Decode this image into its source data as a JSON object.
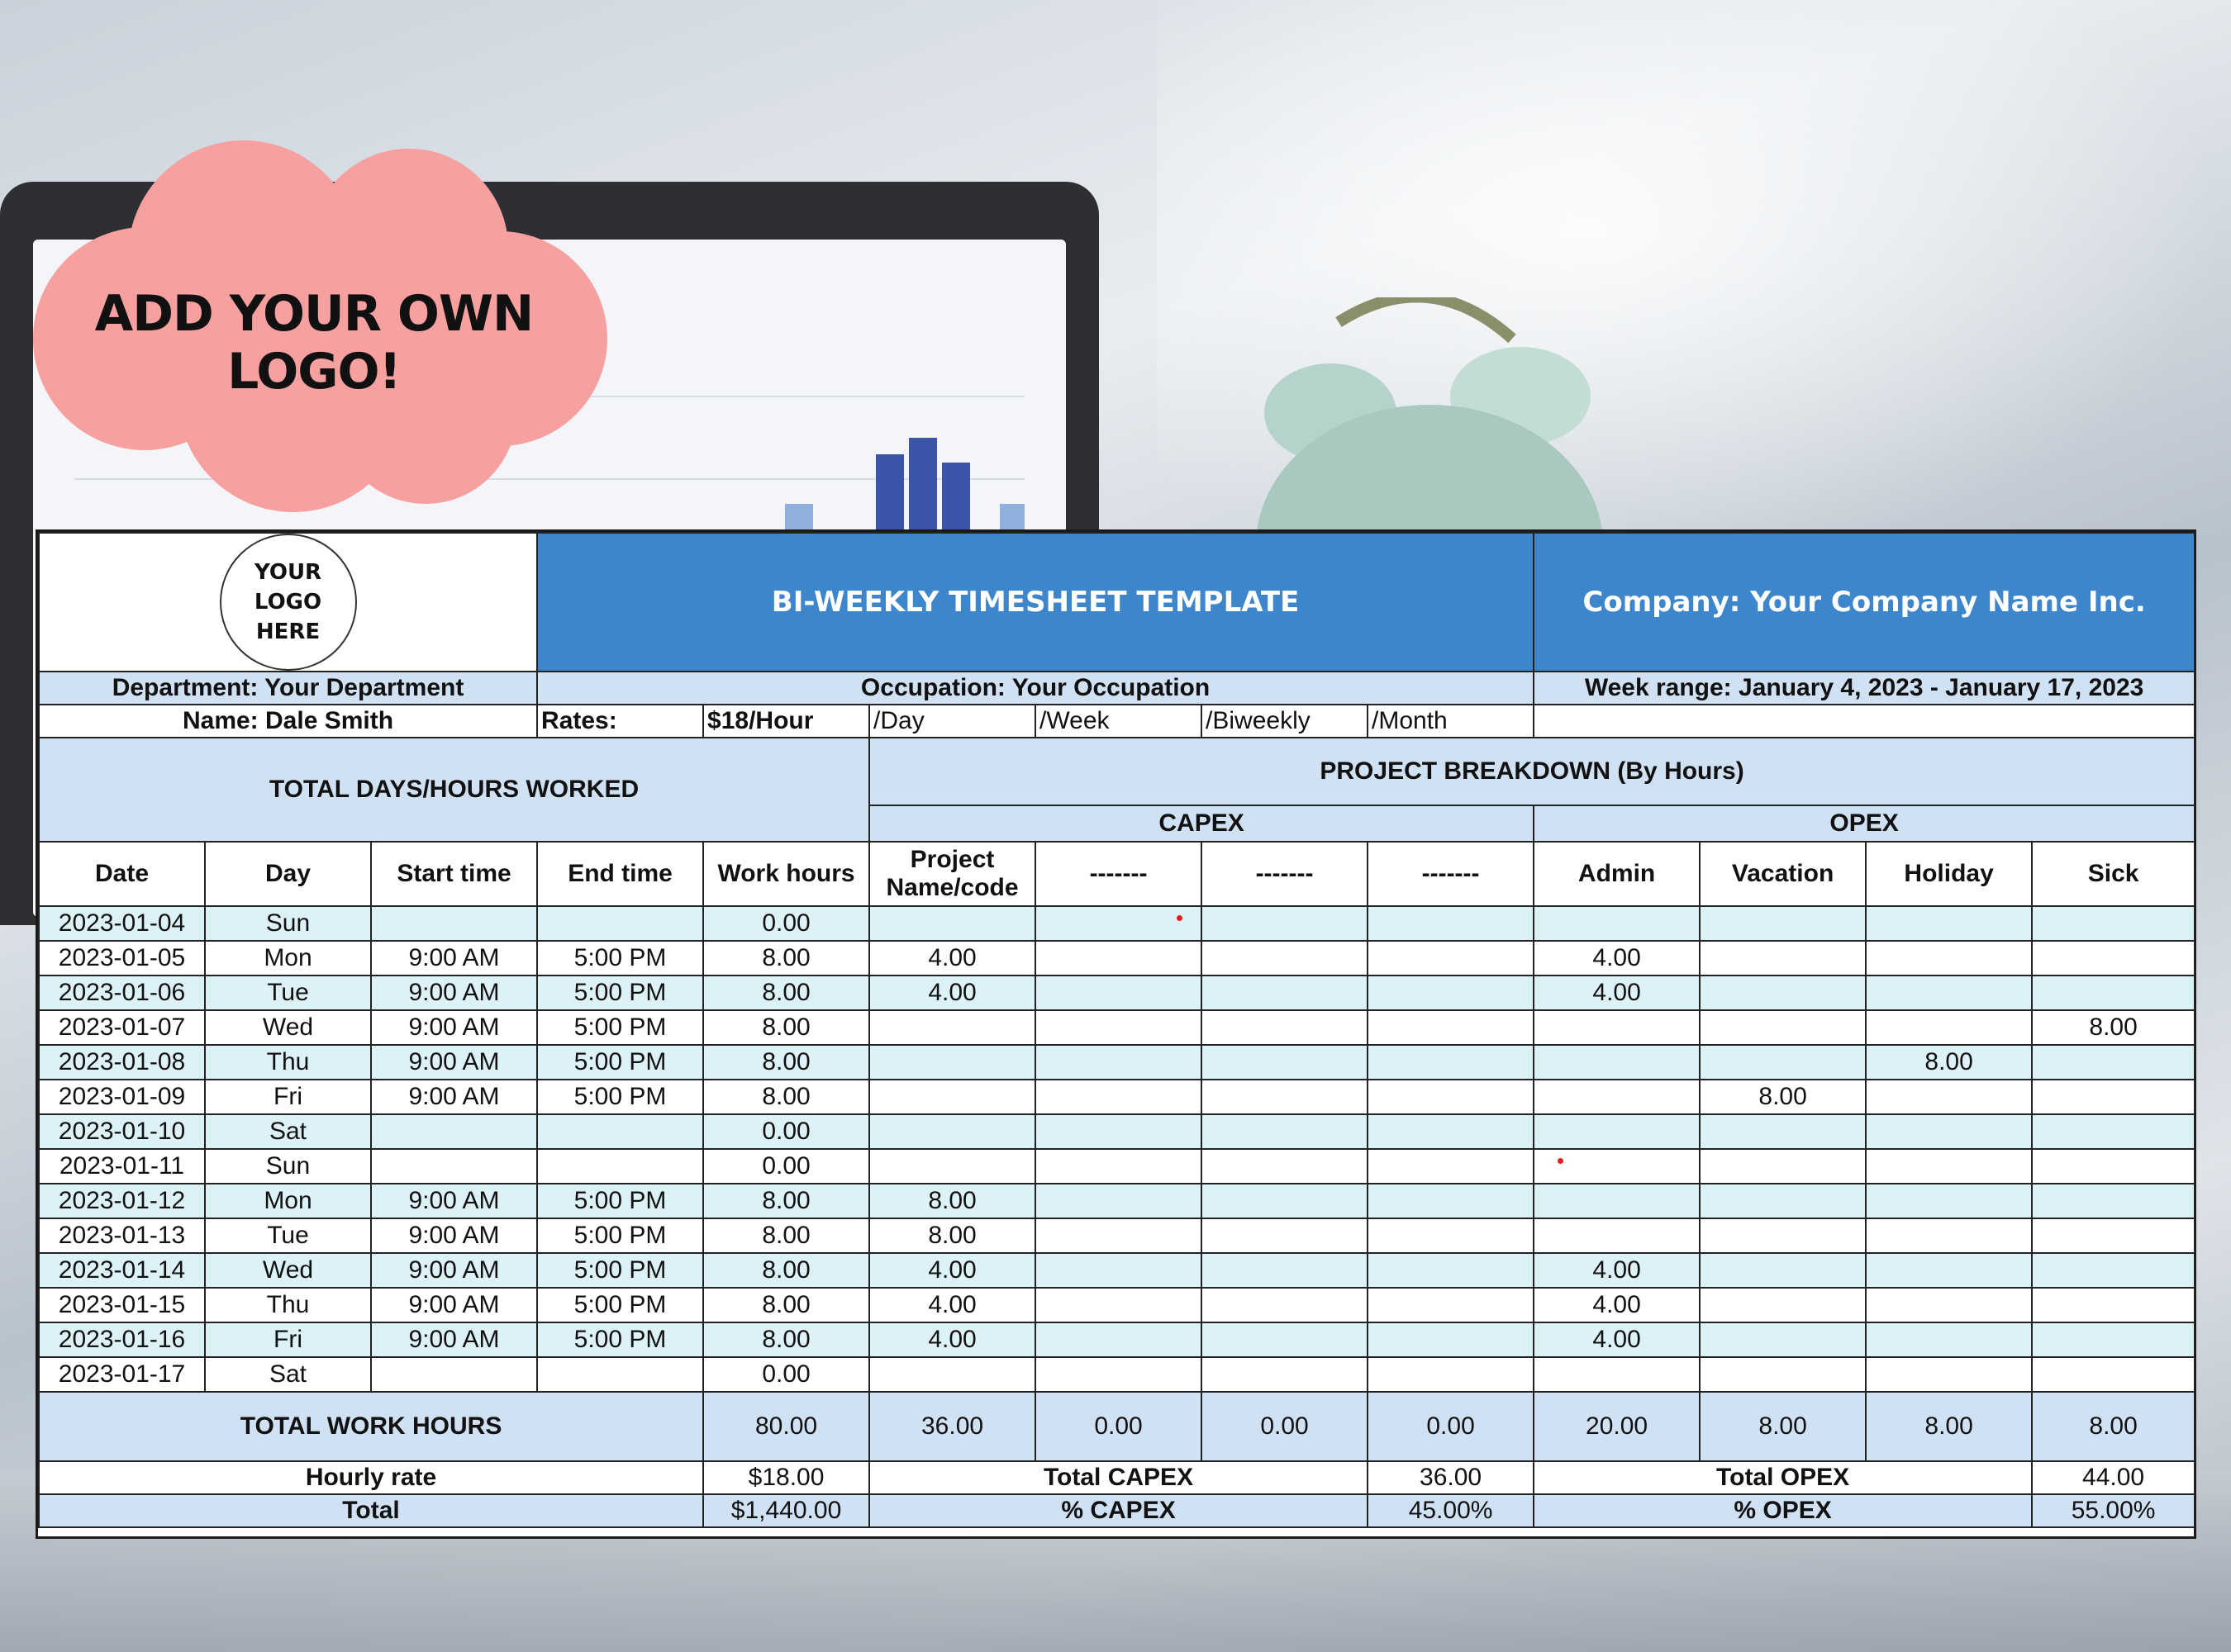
{
  "promo": {
    "cloud_text": "ADD YOUR OWN LOGO!",
    "cloud_color": "#f6a0a0"
  },
  "header": {
    "logo_lines": [
      "YOUR",
      "LOGO",
      "HERE"
    ],
    "title": "BI-WEEKLY TIMESHEET TEMPLATE",
    "company": "Company: Your Company Name Inc.",
    "accent": "#3d86cb"
  },
  "info": {
    "department": "Department: Your Department",
    "occupation": "Occupation: Your Occupation",
    "week_range": "Week range: January 4, 2023 - January 17, 2023",
    "name": "Name: Dale Smith",
    "rates_label": "Rates:",
    "rate_hour": "$18/Hour",
    "rate_day": "/Day",
    "rate_week": "/Week",
    "rate_biweekly": "/Biweekly",
    "rate_month": "/Month"
  },
  "sections": {
    "total_days": "TOTAL DAYS/HOURS WORKED",
    "project_breakdown": "PROJECT BREAKDOWN (By Hours)",
    "capex": "CAPEX",
    "opex": "OPEX"
  },
  "columns": [
    "Date",
    "Day",
    "Start time",
    "End time",
    "Work hours",
    "Project Name/code",
    "-------",
    "-------",
    "-------",
    "Admin",
    "Vacation",
    "Holiday",
    "Sick"
  ],
  "rows": [
    {
      "date": "2023-01-04",
      "day": "Sun",
      "start": "",
      "end": "",
      "hours": "0.00",
      "project": "",
      "c2": "",
      "c3": "",
      "c4": "",
      "admin": "",
      "vacation": "",
      "holiday": "",
      "sick": ""
    },
    {
      "date": "2023-01-05",
      "day": "Mon",
      "start": "9:00 AM",
      "end": "5:00 PM",
      "hours": "8.00",
      "project": "4.00",
      "c2": "",
      "c3": "",
      "c4": "",
      "admin": "4.00",
      "vacation": "",
      "holiday": "",
      "sick": ""
    },
    {
      "date": "2023-01-06",
      "day": "Tue",
      "start": "9:00 AM",
      "end": "5:00 PM",
      "hours": "8.00",
      "project": "4.00",
      "c2": "",
      "c3": "",
      "c4": "",
      "admin": "4.00",
      "vacation": "",
      "holiday": "",
      "sick": ""
    },
    {
      "date": "2023-01-07",
      "day": "Wed",
      "start": "9:00 AM",
      "end": "5:00 PM",
      "hours": "8.00",
      "project": "",
      "c2": "",
      "c3": "",
      "c4": "",
      "admin": "",
      "vacation": "",
      "holiday": "",
      "sick": "8.00"
    },
    {
      "date": "2023-01-08",
      "day": "Thu",
      "start": "9:00 AM",
      "end": "5:00 PM",
      "hours": "8.00",
      "project": "",
      "c2": "",
      "c3": "",
      "c4": "",
      "admin": "",
      "vacation": "",
      "holiday": "8.00",
      "sick": ""
    },
    {
      "date": "2023-01-09",
      "day": "Fri",
      "start": "9:00 AM",
      "end": "5:00 PM",
      "hours": "8.00",
      "project": "",
      "c2": "",
      "c3": "",
      "c4": "",
      "admin": "",
      "vacation": "8.00",
      "holiday": "",
      "sick": ""
    },
    {
      "date": "2023-01-10",
      "day": "Sat",
      "start": "",
      "end": "",
      "hours": "0.00",
      "project": "",
      "c2": "",
      "c3": "",
      "c4": "",
      "admin": "",
      "vacation": "",
      "holiday": "",
      "sick": ""
    },
    {
      "date": "2023-01-11",
      "day": "Sun",
      "start": "",
      "end": "",
      "hours": "0.00",
      "project": "",
      "c2": "",
      "c3": "",
      "c4": "",
      "admin": "",
      "vacation": "",
      "holiday": "",
      "sick": ""
    },
    {
      "date": "2023-01-12",
      "day": "Mon",
      "start": "9:00 AM",
      "end": "5:00 PM",
      "hours": "8.00",
      "project": "8.00",
      "c2": "",
      "c3": "",
      "c4": "",
      "admin": "",
      "vacation": "",
      "holiday": "",
      "sick": ""
    },
    {
      "date": "2023-01-13",
      "day": "Tue",
      "start": "9:00 AM",
      "end": "5:00 PM",
      "hours": "8.00",
      "project": "8.00",
      "c2": "",
      "c3": "",
      "c4": "",
      "admin": "",
      "vacation": "",
      "holiday": "",
      "sick": ""
    },
    {
      "date": "2023-01-14",
      "day": "Wed",
      "start": "9:00 AM",
      "end": "5:00 PM",
      "hours": "8.00",
      "project": "4.00",
      "c2": "",
      "c3": "",
      "c4": "",
      "admin": "4.00",
      "vacation": "",
      "holiday": "",
      "sick": ""
    },
    {
      "date": "2023-01-15",
      "day": "Thu",
      "start": "9:00 AM",
      "end": "5:00 PM",
      "hours": "8.00",
      "project": "4.00",
      "c2": "",
      "c3": "",
      "c4": "",
      "admin": "4.00",
      "vacation": "",
      "holiday": "",
      "sick": ""
    },
    {
      "date": "2023-01-16",
      "day": "Fri",
      "start": "9:00 AM",
      "end": "5:00 PM",
      "hours": "8.00",
      "project": "4.00",
      "c2": "",
      "c3": "",
      "c4": "",
      "admin": "4.00",
      "vacation": "",
      "holiday": "",
      "sick": ""
    },
    {
      "date": "2023-01-17",
      "day": "Sat",
      "start": "",
      "end": "",
      "hours": "0.00",
      "project": "",
      "c2": "",
      "c3": "",
      "c4": "",
      "admin": "",
      "vacation": "",
      "holiday": "",
      "sick": ""
    }
  ],
  "totals": {
    "label": "TOTAL WORK HOURS",
    "hours": "80.00",
    "project": "36.00",
    "c2": "0.00",
    "c3": "0.00",
    "c4": "0.00",
    "admin": "20.00",
    "vacation": "8.00",
    "holiday": "8.00",
    "sick": "8.00"
  },
  "summary": {
    "hourly_rate_label": "Hourly rate",
    "hourly_rate": "$18.00",
    "total_label": "Total",
    "total": "$1,440.00",
    "total_capex_label": "Total CAPEX",
    "total_capex": "36.00",
    "pct_capex_label": "% CAPEX",
    "pct_capex": "45.00%",
    "total_opex_label": "Total OPEX",
    "total_opex": "44.00",
    "pct_opex_label": "% OPEX",
    "pct_opex": "55.00%"
  }
}
